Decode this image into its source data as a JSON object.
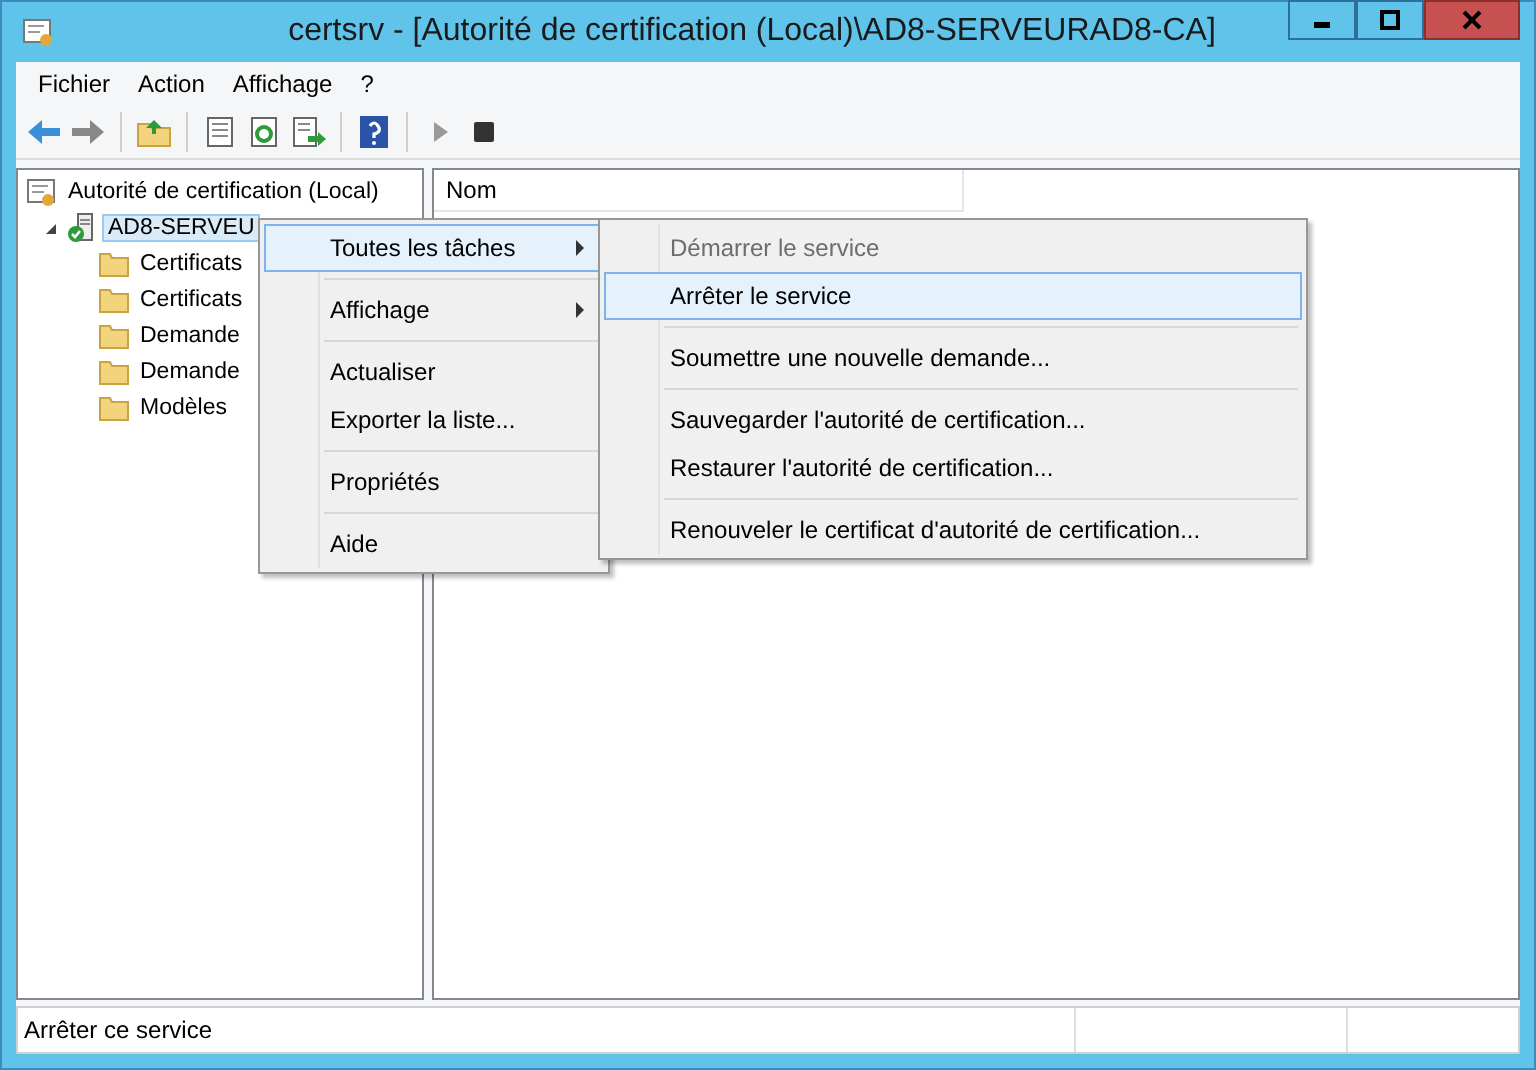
{
  "window": {
    "title": "certsrv - [Autorité de certification (Local)\\AD8-SERVEURAD8-CA]"
  },
  "menu_bar": [
    "Fichier",
    "Action",
    "Affichage",
    "?"
  ],
  "tree": [
    {
      "label": "Autorité de certification (Local)",
      "kind": "root",
      "selected": false,
      "children": [
        {
          "label": "AD8-SERVEU",
          "kind": "server",
          "expanded": true,
          "selected": true,
          "children": [
            {
              "label": "Certificats",
              "kind": "folder",
              "selected": false
            },
            {
              "label": "Certificats",
              "kind": "folder",
              "selected": false
            },
            {
              "label": "Demande",
              "kind": "folder",
              "selected": false
            },
            {
              "label": "Demande",
              "kind": "folder",
              "selected": false
            },
            {
              "label": "Modèles",
              "kind": "folder",
              "selected": false
            }
          ]
        }
      ]
    }
  ],
  "list": {
    "columns": [
      "Nom"
    ]
  },
  "context_menu": [
    {
      "kind": "item",
      "label": "Toutes les tâches",
      "submenu": true,
      "selected": true,
      "disabled": false
    },
    {
      "kind": "separator"
    },
    {
      "kind": "item",
      "label": "Affichage",
      "submenu": true,
      "selected": false,
      "disabled": false
    },
    {
      "kind": "separator"
    },
    {
      "kind": "item",
      "label": "Actualiser",
      "submenu": false,
      "selected": false,
      "disabled": false
    },
    {
      "kind": "item",
      "label": "Exporter la liste...",
      "submenu": false,
      "selected": false,
      "disabled": false
    },
    {
      "kind": "separator"
    },
    {
      "kind": "item",
      "label": "Propriétés",
      "submenu": false,
      "selected": false,
      "disabled": false
    },
    {
      "kind": "separator"
    },
    {
      "kind": "item",
      "label": "Aide",
      "submenu": false,
      "selected": false,
      "disabled": false
    }
  ],
  "submenu": [
    {
      "kind": "item",
      "label": "Démarrer le service",
      "selected": false,
      "disabled": true
    },
    {
      "kind": "item",
      "label": "Arrêter le service",
      "selected": true,
      "disabled": false
    },
    {
      "kind": "separator"
    },
    {
      "kind": "item",
      "label": "Soumettre une nouvelle demande...",
      "selected": false,
      "disabled": false
    },
    {
      "kind": "separator"
    },
    {
      "kind": "item",
      "label": "Sauvegarder l'autorité de certification...",
      "selected": false,
      "disabled": false
    },
    {
      "kind": "item",
      "label": "Restaurer l'autorité de certification...",
      "selected": false,
      "disabled": false
    },
    {
      "kind": "separator"
    },
    {
      "kind": "item",
      "label": "Renouveler le certificat d'autorité de certification...",
      "selected": false,
      "disabled": false
    }
  ],
  "status_bar": {
    "text": "Arrêter ce service"
  }
}
